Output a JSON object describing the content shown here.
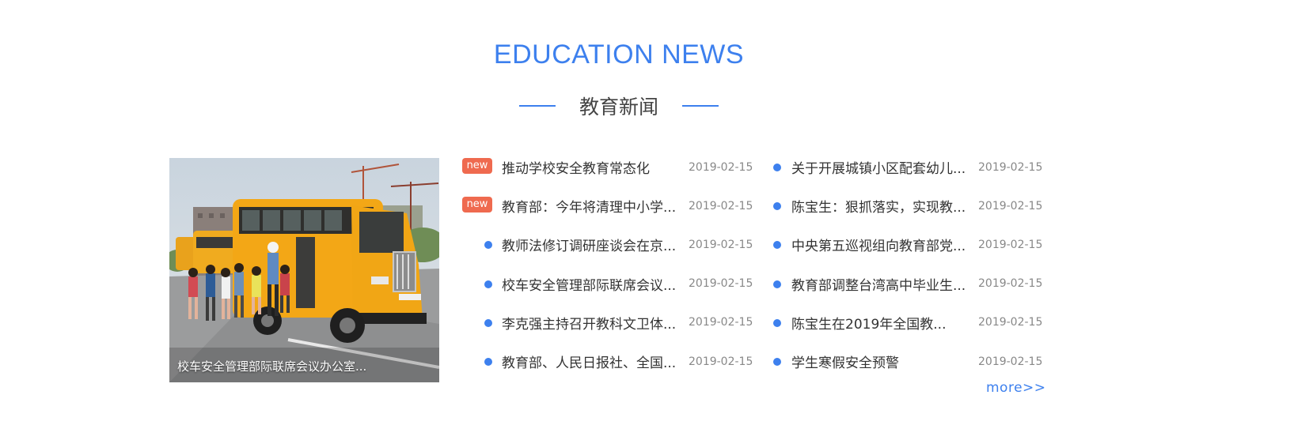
{
  "header": {
    "title_en": "EDUCATION NEWS",
    "title_zh": "教育新闻"
  },
  "feature": {
    "caption": "校车安全管理部际联席会议办公室..."
  },
  "news_left": [
    {
      "title": "推动学校安全教育常态化",
      "date": "2019-02-15",
      "badge": "new"
    },
    {
      "title": "教育部：今年将清理中小学...",
      "date": "2019-02-15",
      "badge": "new"
    },
    {
      "title": "教师法修订调研座谈会在京...",
      "date": "2019-02-15"
    },
    {
      "title": "校车安全管理部际联席会议...",
      "date": "2019-02-15"
    },
    {
      "title": "李克强主持召开教科文卫体...",
      "date": "2019-02-15"
    },
    {
      "title": "教育部、人民日报社、全国...",
      "date": "2019-02-15"
    }
  ],
  "news_right": [
    {
      "title": "关于开展城镇小区配套幼儿...",
      "date": "2019-02-15"
    },
    {
      "title": "陈宝生：狠抓落实，实现教...",
      "date": "2019-02-15"
    },
    {
      "title": "中央第五巡视组向教育部党...",
      "date": "2019-02-15"
    },
    {
      "title": "教育部调整台湾高中毕业生...",
      "date": "2019-02-15"
    },
    {
      "title": "陈宝生在2019年全国教...",
      "date": "2019-02-15"
    },
    {
      "title": "学生寒假安全预警",
      "date": "2019-02-15"
    }
  ],
  "more_label": "more>>",
  "colors": {
    "accent": "#3d80ee",
    "badge": "#ef6a4f",
    "text": "#333333",
    "date": "#888888"
  }
}
